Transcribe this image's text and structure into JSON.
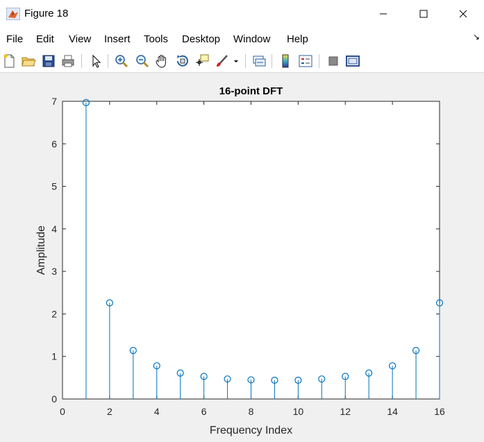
{
  "window": {
    "title": "Figure 18"
  },
  "menu": [
    "File",
    "Edit",
    "View",
    "Insert",
    "Tools",
    "Desktop",
    "Window",
    "Help"
  ],
  "toolbar_icons": [
    "new-figure-icon",
    "open-file-icon",
    "save-icon",
    "print-icon",
    "pointer-icon",
    "zoom-in-icon",
    "zoom-out-icon",
    "pan-icon",
    "rotate-3d-icon",
    "data-cursor-icon",
    "brush-icon",
    "brush-dropdown-icon",
    "link-plot-icon",
    "colorbar-icon",
    "legend-icon",
    "hide-plot-tools-icon",
    "show-plot-tools-icon"
  ],
  "colors": {
    "stem": "#0072bd",
    "axes_bg": "#ffffff",
    "figure_bg": "#f0f0f0"
  },
  "chart_data": {
    "type": "stem",
    "title": "16-point DFT",
    "xlabel": "Frequency Index",
    "ylabel": "Amplitude",
    "xlim": [
      0,
      16
    ],
    "ylim": [
      0,
      7
    ],
    "xticks": [
      0,
      2,
      4,
      6,
      8,
      10,
      12,
      14,
      16
    ],
    "yticks": [
      0,
      1,
      2,
      3,
      4,
      5,
      6,
      7
    ],
    "x": [
      1,
      2,
      3,
      4,
      5,
      6,
      7,
      8,
      9,
      10,
      11,
      12,
      13,
      14,
      15,
      16
    ],
    "y": [
      6.97,
      2.26,
      1.14,
      0.78,
      0.61,
      0.53,
      0.47,
      0.45,
      0.44,
      0.44,
      0.47,
      0.53,
      0.61,
      0.78,
      1.14,
      2.26
    ],
    "grid": false
  }
}
